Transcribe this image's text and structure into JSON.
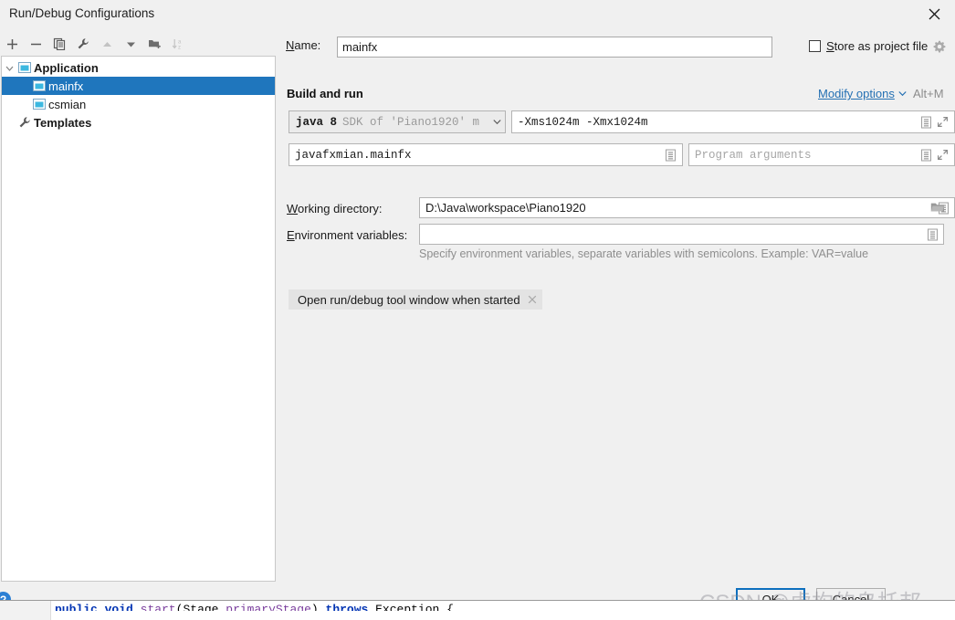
{
  "window": {
    "title": "Run/Debug Configurations",
    "close_icon": "close-icon"
  },
  "toolbar": {
    "buttons": [
      {
        "name": "add-configuration-button",
        "icon": "plus-icon",
        "label": "+"
      },
      {
        "name": "remove-configuration-button",
        "icon": "minus-icon",
        "label": "−"
      },
      {
        "name": "copy-configuration-button",
        "icon": "copy-icon",
        "label": "Copy"
      },
      {
        "name": "edit-templates-button",
        "icon": "wrench-icon",
        "label": "Edit Templates"
      },
      {
        "name": "move-up-button",
        "icon": "arrow-up-icon",
        "label": "Move Up"
      },
      {
        "name": "move-down-button",
        "icon": "arrow-down-icon",
        "label": "Move Down"
      },
      {
        "name": "new-folder-button",
        "icon": "folder-add-icon",
        "label": "New Folder"
      },
      {
        "name": "sort-configurations-button",
        "icon": "sort-az-icon",
        "label": "Sort Configurations"
      }
    ]
  },
  "tree": {
    "nodes": [
      {
        "label": "Application",
        "bold": true,
        "indent": 0,
        "selected": false,
        "icon": "application-icon",
        "expanded": true
      },
      {
        "label": "mainfx",
        "bold": false,
        "indent": 1,
        "selected": true,
        "icon": "application-icon",
        "expanded": false
      },
      {
        "label": "csmian",
        "bold": false,
        "indent": 1,
        "selected": false,
        "icon": "application-icon",
        "expanded": false
      },
      {
        "label": "Templates",
        "bold": true,
        "indent": 0,
        "selected": false,
        "icon": "wrench-icon",
        "expanded": false
      }
    ],
    "selection_color": "#1f76bd"
  },
  "form": {
    "name_label": "Name:",
    "name_label_mnemonic": "N",
    "name_label_rest": "ame:",
    "name_value": "mainfx",
    "store_as_project_file_label": "Store as project file",
    "store_as_project_file_mnemonic": "S",
    "store_as_project_file_rest": "tore as project file",
    "store_as_project_file_checked": false,
    "store_gear_icon": "gear-icon",
    "section_title": "Build and run",
    "modify_options_label": "Modify options",
    "modify_options_mnemonic": "M",
    "modify_options_rest": "odify options",
    "modify_options_shortcut": "Alt+M",
    "modify_options_color": "#2470b3",
    "jdk_main": "java 8",
    "jdk_sub": "SDK of 'Piano1920' m",
    "vm_options_value": "-Xms1024m -Xmx1024m",
    "vm_options_list_icon": "document-list-icon",
    "vm_options_expand_icon": "expand-icon",
    "main_class_value": "javafxmian.mainfx",
    "main_class_list_icon": "document-list-icon",
    "program_arguments_placeholder": "Program arguments",
    "program_arguments_value": "",
    "program_arguments_list_icon": "document-list-icon",
    "program_arguments_expand_icon": "expand-icon",
    "working_directory_label": "Working directory:",
    "working_directory_mnemonic": "W",
    "working_directory_rest": "orking directory:",
    "working_directory_value": "D:\\Java\\workspace\\Piano1920",
    "working_directory_list_icon": "document-list-icon",
    "working_directory_browse_icon": "folder-icon",
    "environment_variables_label": "Environment variables:",
    "environment_variables_mnemonic": "E",
    "environment_variables_rest": "nvironment variables:",
    "environment_variables_value": "",
    "environment_variables_list_icon": "document-list-icon",
    "environment_variables_hint": "Specify environment variables, separate variables with semicolons. Example: VAR=value",
    "chip_label": "Open run/debug tool window when started",
    "chip_close_icon": "close-small-icon"
  },
  "footer": {
    "help_icon": "help-icon",
    "help_label": "?",
    "ok_label": "OK",
    "cancel_label": "Cancel"
  },
  "watermark": {
    "text": "CSDN @虚构的乌托邦"
  }
}
